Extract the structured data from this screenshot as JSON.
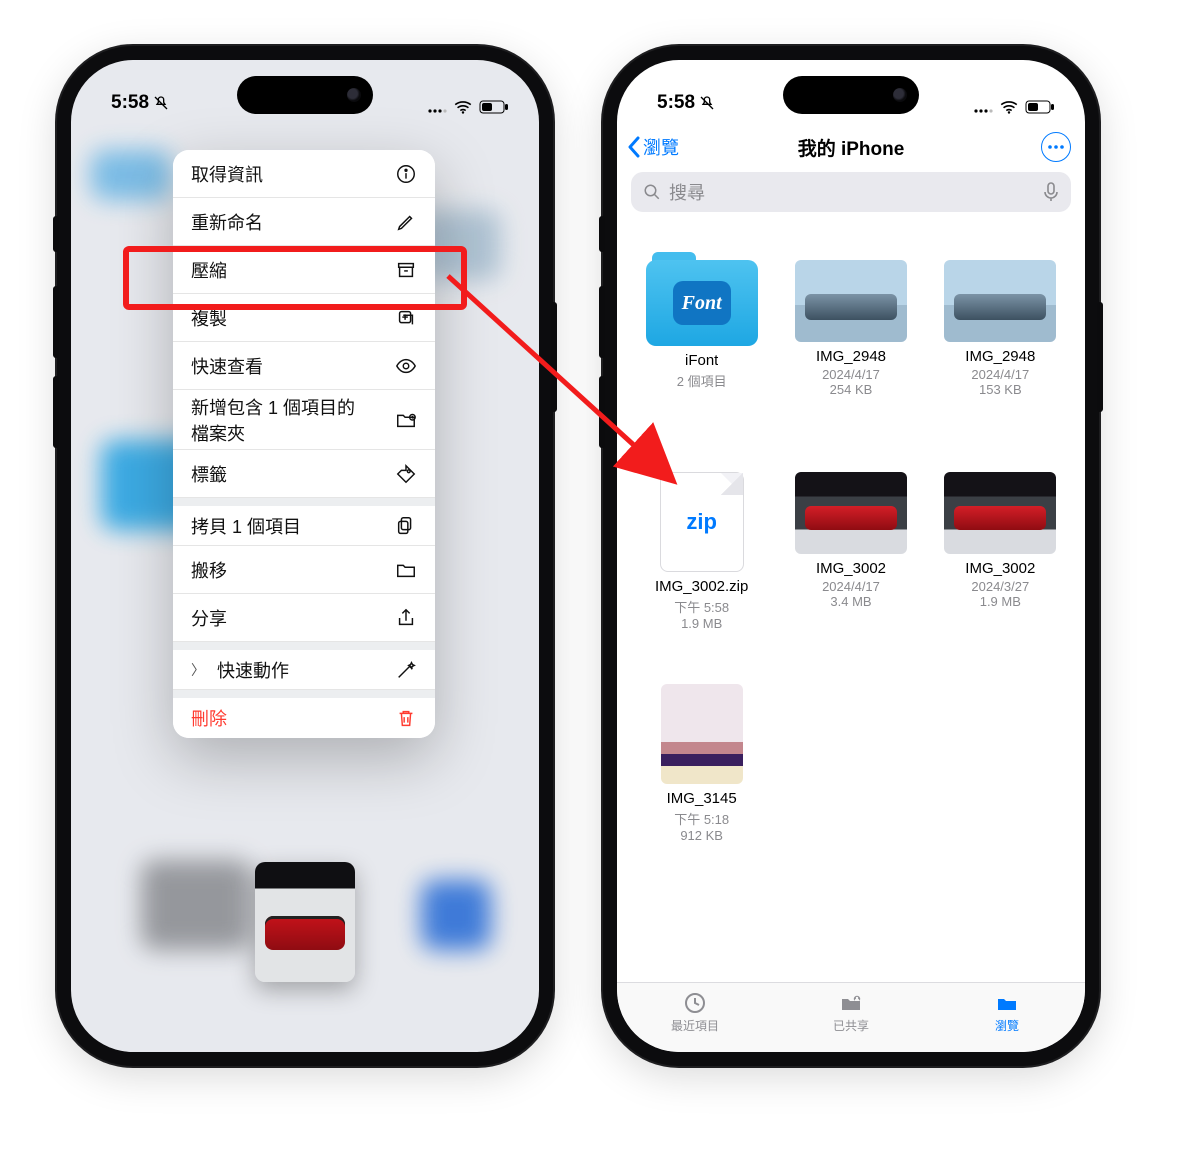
{
  "status": {
    "time": "5:58"
  },
  "left": {
    "menu": {
      "get_info": "取得資訊",
      "rename": "重新命名",
      "compress": "壓縮",
      "duplicate": "複製",
      "quick_look": "快速查看",
      "new_folder": "新增包含 1 個項目的檔案夾",
      "tags": "標籤",
      "copy": "拷貝 1 個項目",
      "move": "搬移",
      "share": "分享",
      "quick_actions": "快速動作",
      "delete": "刪除"
    }
  },
  "right": {
    "nav": {
      "back": "瀏覽",
      "title": "我的 iPhone"
    },
    "search": {
      "placeholder": "搜尋"
    },
    "files": [
      {
        "name": "iFont",
        "meta1": "2 個項目",
        "meta2": ""
      },
      {
        "name": "IMG_2948",
        "meta1": "2024/4/17",
        "meta2": "254 KB"
      },
      {
        "name": "IMG_2948",
        "meta1": "2024/4/17",
        "meta2": "153 KB"
      },
      {
        "name": "IMG_3002.zip",
        "meta1": "下午 5:58",
        "meta2": "1.9 MB"
      },
      {
        "name": "IMG_3002",
        "meta1": "2024/4/17",
        "meta2": "3.4 MB"
      },
      {
        "name": "IMG_3002",
        "meta1": "2024/3/27",
        "meta2": "1.9 MB"
      },
      {
        "name": "IMG_3145",
        "meta1": "下午 5:18",
        "meta2": "912 KB"
      }
    ],
    "folder_badge": "Font",
    "zip_label": "zip",
    "tabs": {
      "recent": "最近項目",
      "shared": "已共享",
      "browse": "瀏覽"
    }
  }
}
